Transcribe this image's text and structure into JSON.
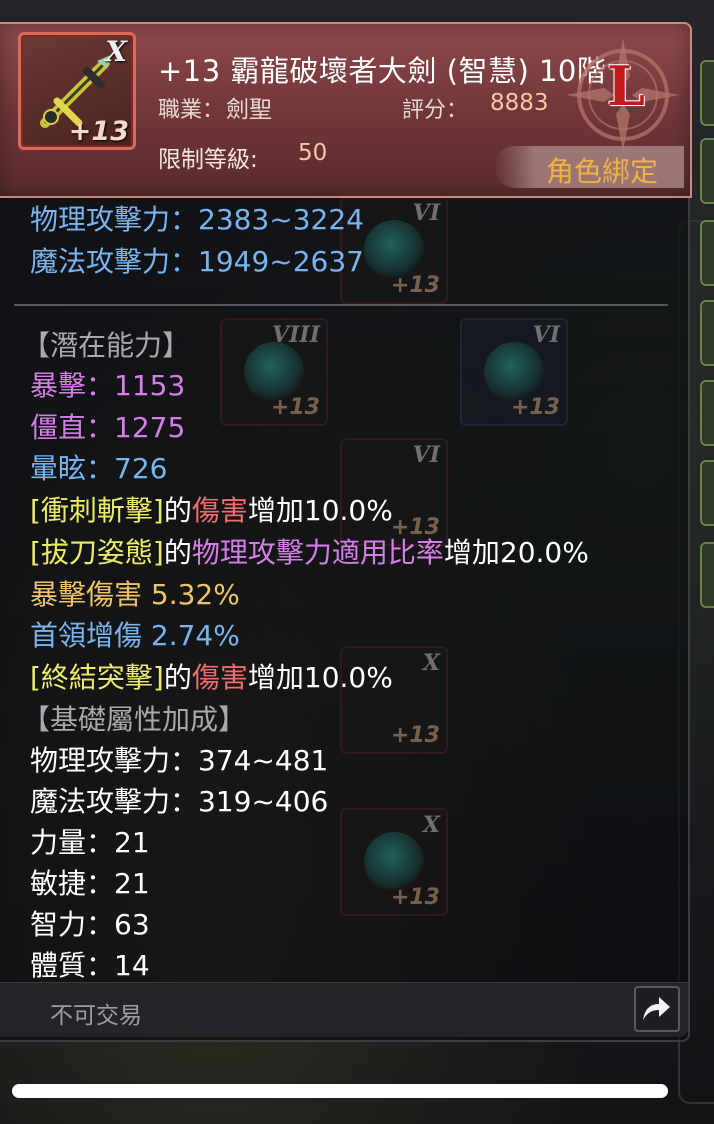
{
  "header": {
    "item_name": "+13 霸龍破壞者大劍 (智慧) 10階",
    "job_label": "職業：",
    "job_value": "劍聖",
    "score_label": "評分：",
    "score_value": "8883",
    "level_label": "限制等級:",
    "level_value": "50",
    "bind_label": "角色綁定",
    "icon_grade": "X",
    "icon_plus": "+13",
    "emblem_letter": "L"
  },
  "base_stats": [
    {
      "label": "物理攻擊力：2383~3224"
    },
    {
      "label": "魔法攻擊力：1949~2637"
    }
  ],
  "potential": {
    "title": "【潛在能力】",
    "crit": "暴擊：1153",
    "stiff": "僵直：1275",
    "stun": "暈眩：726",
    "line1_skill": "[衝刺斬擊]",
    "line1_of": "的",
    "line1_attr": "傷害",
    "line1_inc": "增加10.0%",
    "line2_skill": "[拔刀姿態]",
    "line2_of": "的",
    "line2_attr": "物理攻擊力適用比率",
    "line2_inc": "增加20.0%",
    "crit_dmg": "暴擊傷害 5.32%",
    "boss_dmg": "首領增傷 2.74%",
    "line3_skill": "[終結突擊]",
    "line3_of": "的",
    "line3_attr": "傷害",
    "line3_inc": "增加10.0%"
  },
  "bonus": {
    "title": "【基礎屬性加成】",
    "phys": "物理攻擊力：374~481",
    "magic": "魔法攻擊力：319~406",
    "str": "力量：21",
    "agi": "敏捷：21",
    "int": "智力：63",
    "vit": "體質：14"
  },
  "footer": {
    "trade_text": "不可交易"
  },
  "ghost_labels": {
    "g1_roman": "VI",
    "g1_plus": "+13",
    "g2_roman": "VIII",
    "g2_plus": "+13",
    "g3_roman": "VI",
    "g3_plus": "+13",
    "g4_roman": "VI",
    "g4_plus": "+13",
    "g5_roman": "X",
    "g5_plus": "+13",
    "g6_roman": "X",
    "g6_plus": "+13"
  },
  "colors": {
    "header_bg": "#8e4a4c",
    "blue_text": "#78b4f0",
    "purple_text": "#d57ee8",
    "gold_text": "#f0c26a",
    "yellow_text": "#ecec6a",
    "red_text": "#ef6d6d",
    "bind_text": "#f0b244"
  }
}
